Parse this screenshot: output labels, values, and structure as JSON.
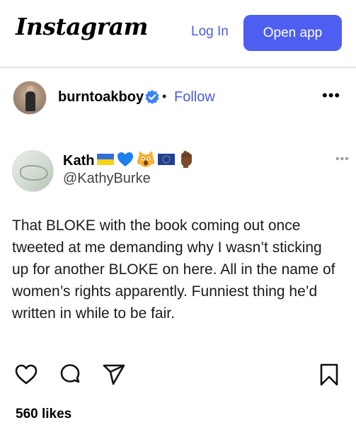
{
  "header": {
    "logo_text": "Instagram",
    "login_label": "Log In",
    "open_app_label": "Open app",
    "accent_color": "#4d5ef0"
  },
  "post": {
    "username": "burntoakboy",
    "verified_icon": "verified-badge-icon",
    "separator": "•",
    "follow_label": "Follow",
    "more_label": "•••",
    "likes_text": "560 likes"
  },
  "tweet": {
    "name": "Kath",
    "emoji_icons": [
      "ukraine-flag-icon",
      "blue-heart-icon",
      "screaming-cat-icon",
      "eu-flag-icon",
      "raised-fist-icon"
    ],
    "handle": "@KathyBurke",
    "more_label": "•••",
    "lines": [
      "That BLOKE with the book coming out once",
      "tweeted at me demanding why I wasn’t sticking",
      "up for another BLOKE on here. All in the name of",
      "women’s rights apparently. Funniest thing he’d",
      "written in while to be fair."
    ]
  },
  "actions": {
    "icons": [
      "heart-icon",
      "comment-icon",
      "share-icon",
      "bookmark-icon"
    ]
  }
}
